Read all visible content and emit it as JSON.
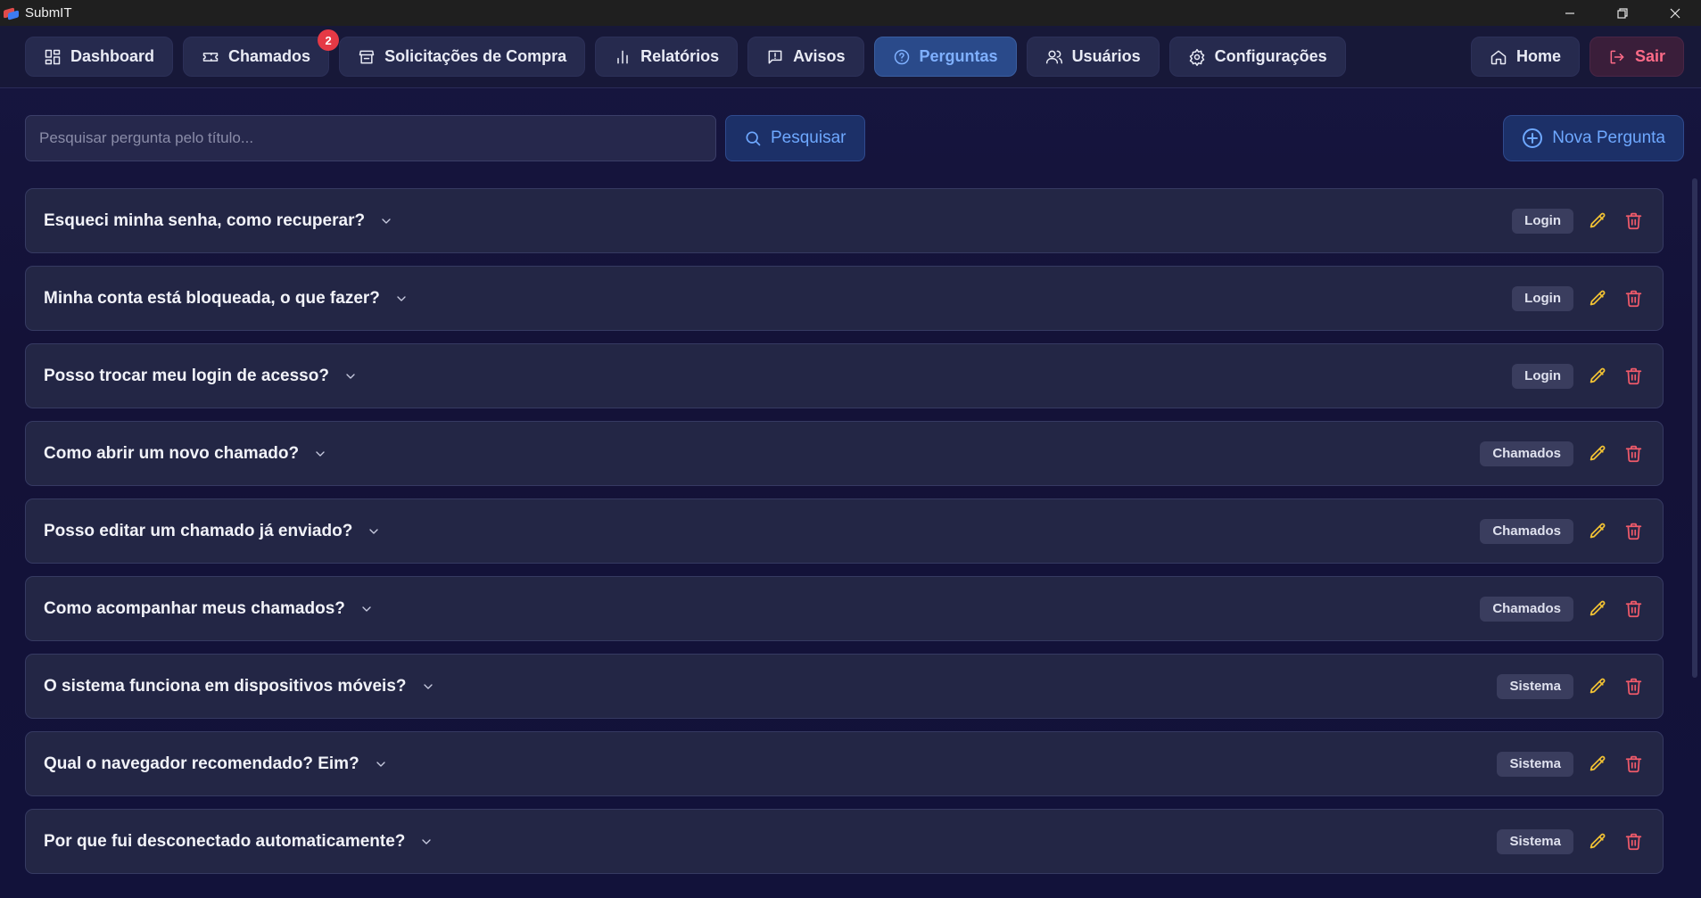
{
  "window": {
    "title": "SubmIT"
  },
  "nav": {
    "items": [
      {
        "label": "Dashboard",
        "icon": "dashboard-icon"
      },
      {
        "label": "Chamados",
        "icon": "ticket-icon",
        "badge": "2"
      },
      {
        "label": "Solicitações de Compra",
        "icon": "store-icon"
      },
      {
        "label": "Relatórios",
        "icon": "bar-chart-icon"
      },
      {
        "label": "Avisos",
        "icon": "message-alert-icon"
      },
      {
        "label": "Perguntas",
        "icon": "help-circle-icon",
        "active": true
      },
      {
        "label": "Usuários",
        "icon": "users-icon"
      },
      {
        "label": "Configurações",
        "icon": "gear-icon"
      }
    ],
    "home_label": "Home",
    "logout_label": "Sair"
  },
  "search": {
    "placeholder": "Pesquisar pergunta pelo título...",
    "value": "",
    "button_label": "Pesquisar",
    "new_label": "Nova Pergunta"
  },
  "faqs": [
    {
      "title": "Esqueci minha senha, como recuperar?",
      "tag": "Login"
    },
    {
      "title": "Minha conta está bloqueada, o que fazer?",
      "tag": "Login"
    },
    {
      "title": "Posso trocar meu login de acesso?",
      "tag": "Login"
    },
    {
      "title": "Como abrir um novo chamado?",
      "tag": "Chamados"
    },
    {
      "title": "Posso editar um chamado já enviado?",
      "tag": "Chamados"
    },
    {
      "title": "Como acompanhar meus chamados?",
      "tag": "Chamados"
    },
    {
      "title": "O sistema funciona em dispositivos móveis?",
      "tag": "Sistema"
    },
    {
      "title": "Qual o navegador recomendado? Eim?",
      "tag": "Sistema"
    },
    {
      "title": "Por que fui desconectado automaticamente?",
      "tag": "Sistema"
    }
  ],
  "colors": {
    "accent": "#6ea8ff",
    "edit": "#f2c233",
    "delete": "#f05a6a",
    "badge": "#e53945"
  }
}
